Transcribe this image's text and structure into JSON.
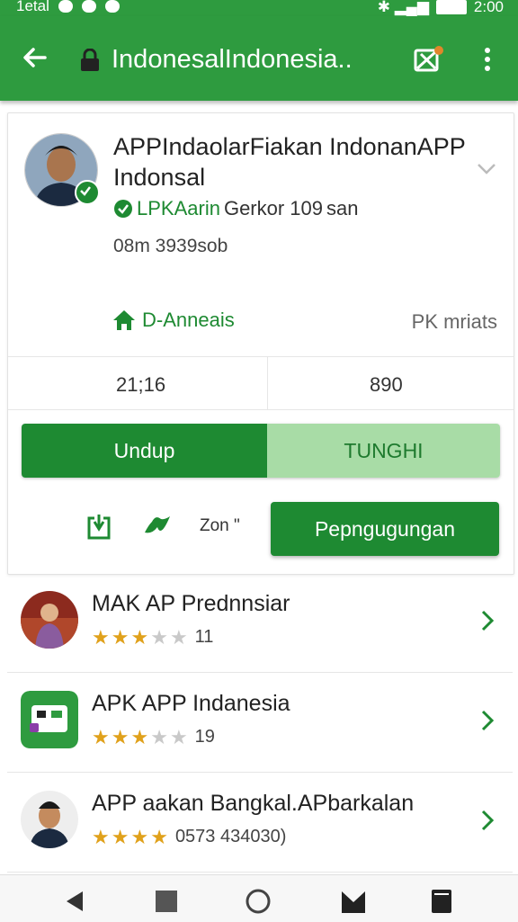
{
  "status_bar": {
    "carrier": "1etal",
    "time": "2:00"
  },
  "app_bar": {
    "title": "IndonesalIndonesia.."
  },
  "app": {
    "name": "APPIndaolarFiakan IndonanAPP Indonsal",
    "developer_brand": "LPKAarin",
    "developer_rest": " Gerkor 109",
    "developer_suffix": "san",
    "meta": "08m 3939sob",
    "category": "D-Anneais",
    "category_right": "PK mriats",
    "stat1": "21;16",
    "stat2": "890",
    "btn_undup": "Undup",
    "btn_tunghi": "TUNGHI",
    "small_label": "Zon \"",
    "primary_btn": "Pepngugungan"
  },
  "related": [
    {
      "name": "MAK AP Prednnsiar",
      "stars_on": 3,
      "count": "11"
    },
    {
      "name": "APK APP Indanesia",
      "stars_on": 3,
      "count": "19"
    },
    {
      "name": "APP aakan Bangkal.APbarkalan",
      "stars_on": 4,
      "count": "0573 434030)"
    }
  ],
  "colors": {
    "brand_green": "#2e9b3f",
    "button_green": "#1e8a32",
    "light_green": "#a8dca6",
    "star": "#e0a11b"
  }
}
